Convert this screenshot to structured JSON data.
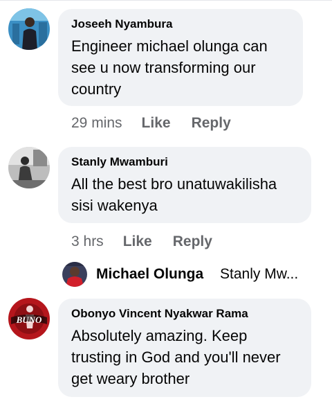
{
  "comments": [
    {
      "author": "Joseeh Nyambura",
      "text": "Engineer michael olunga  can see u now transforming our country",
      "time": "29 mins",
      "like_label": "Like",
      "reply_label": "Reply",
      "avatar_icon": "user-avatar-photo"
    },
    {
      "author": "Stanly Mwamburi",
      "text": "All the best bro unatuwakilisha sisi wakenya",
      "time": "3 hrs",
      "like_label": "Like",
      "reply_label": "Reply",
      "avatar_icon": "user-avatar-photo"
    },
    {
      "author": "Obonyo Vincent Nyakwar Rama",
      "text": "Absolutely amazing. Keep trusting in God and you'll never get weary brother",
      "avatar_icon": "user-avatar-logo"
    }
  ],
  "reply_preview": {
    "author": "Michael Olunga",
    "text": "Stanly Mw...",
    "avatar_icon": "user-avatar-photo"
  },
  "colors": {
    "bubble_bg": "#f0f2f5",
    "meta_text": "#65676b",
    "primary_text": "#050505"
  }
}
